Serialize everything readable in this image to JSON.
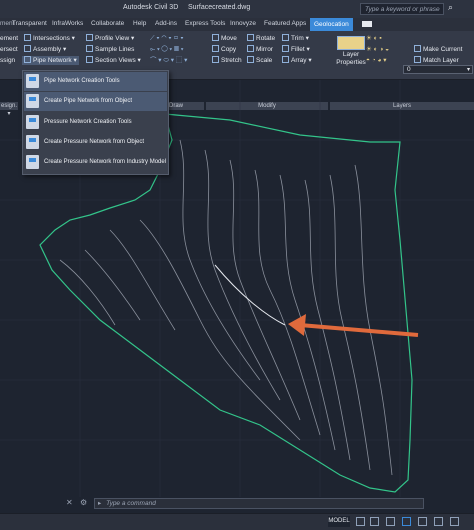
{
  "app": {
    "title": "Autodesk Civil 3D",
    "filename": "Surfacecreated.dwg",
    "search_placeholder": "Type a keyword or phrase"
  },
  "tabs": [
    "Transparent",
    "InfraWorks",
    "Collaborate",
    "Help",
    "Add-ins",
    "Express Tools",
    "Innovyze",
    "Featured Apps",
    "Geolocation"
  ],
  "ribbon": {
    "col1": [
      "ement",
      "ersect",
      "ssign"
    ],
    "col2": [
      "Intersections",
      "Assembly",
      "Pipe Network"
    ],
    "col3": [
      "Profile View",
      "Sample Lines",
      "Section Views"
    ],
    "draw_panel": "Draw",
    "modify_buttons": [
      "Move",
      "Rotate",
      "Trim",
      "Copy",
      "Mirror",
      "Fillet",
      "Stretch",
      "Scale",
      "Array"
    ],
    "modify_panel": "Modify",
    "layer_properties": "Layer Properties",
    "layer_value": "0",
    "layer_buttons": [
      "Make Current",
      "Match Layer"
    ],
    "layers_panel": "Layers"
  },
  "dropdown": [
    "Pipe Network Creation Tools",
    "Create Pipe Network from Object",
    "Pressure Network Creation Tools",
    "Create Pressure Network from Object",
    "Create Pressure Network from Industry Model"
  ],
  "command": {
    "placeholder": "Type a command"
  },
  "status": {
    "model": "MODEL"
  },
  "colors": {
    "boundary": "#33c48a",
    "arrow": "#e06a3c",
    "accent": "#3b8ad9"
  }
}
